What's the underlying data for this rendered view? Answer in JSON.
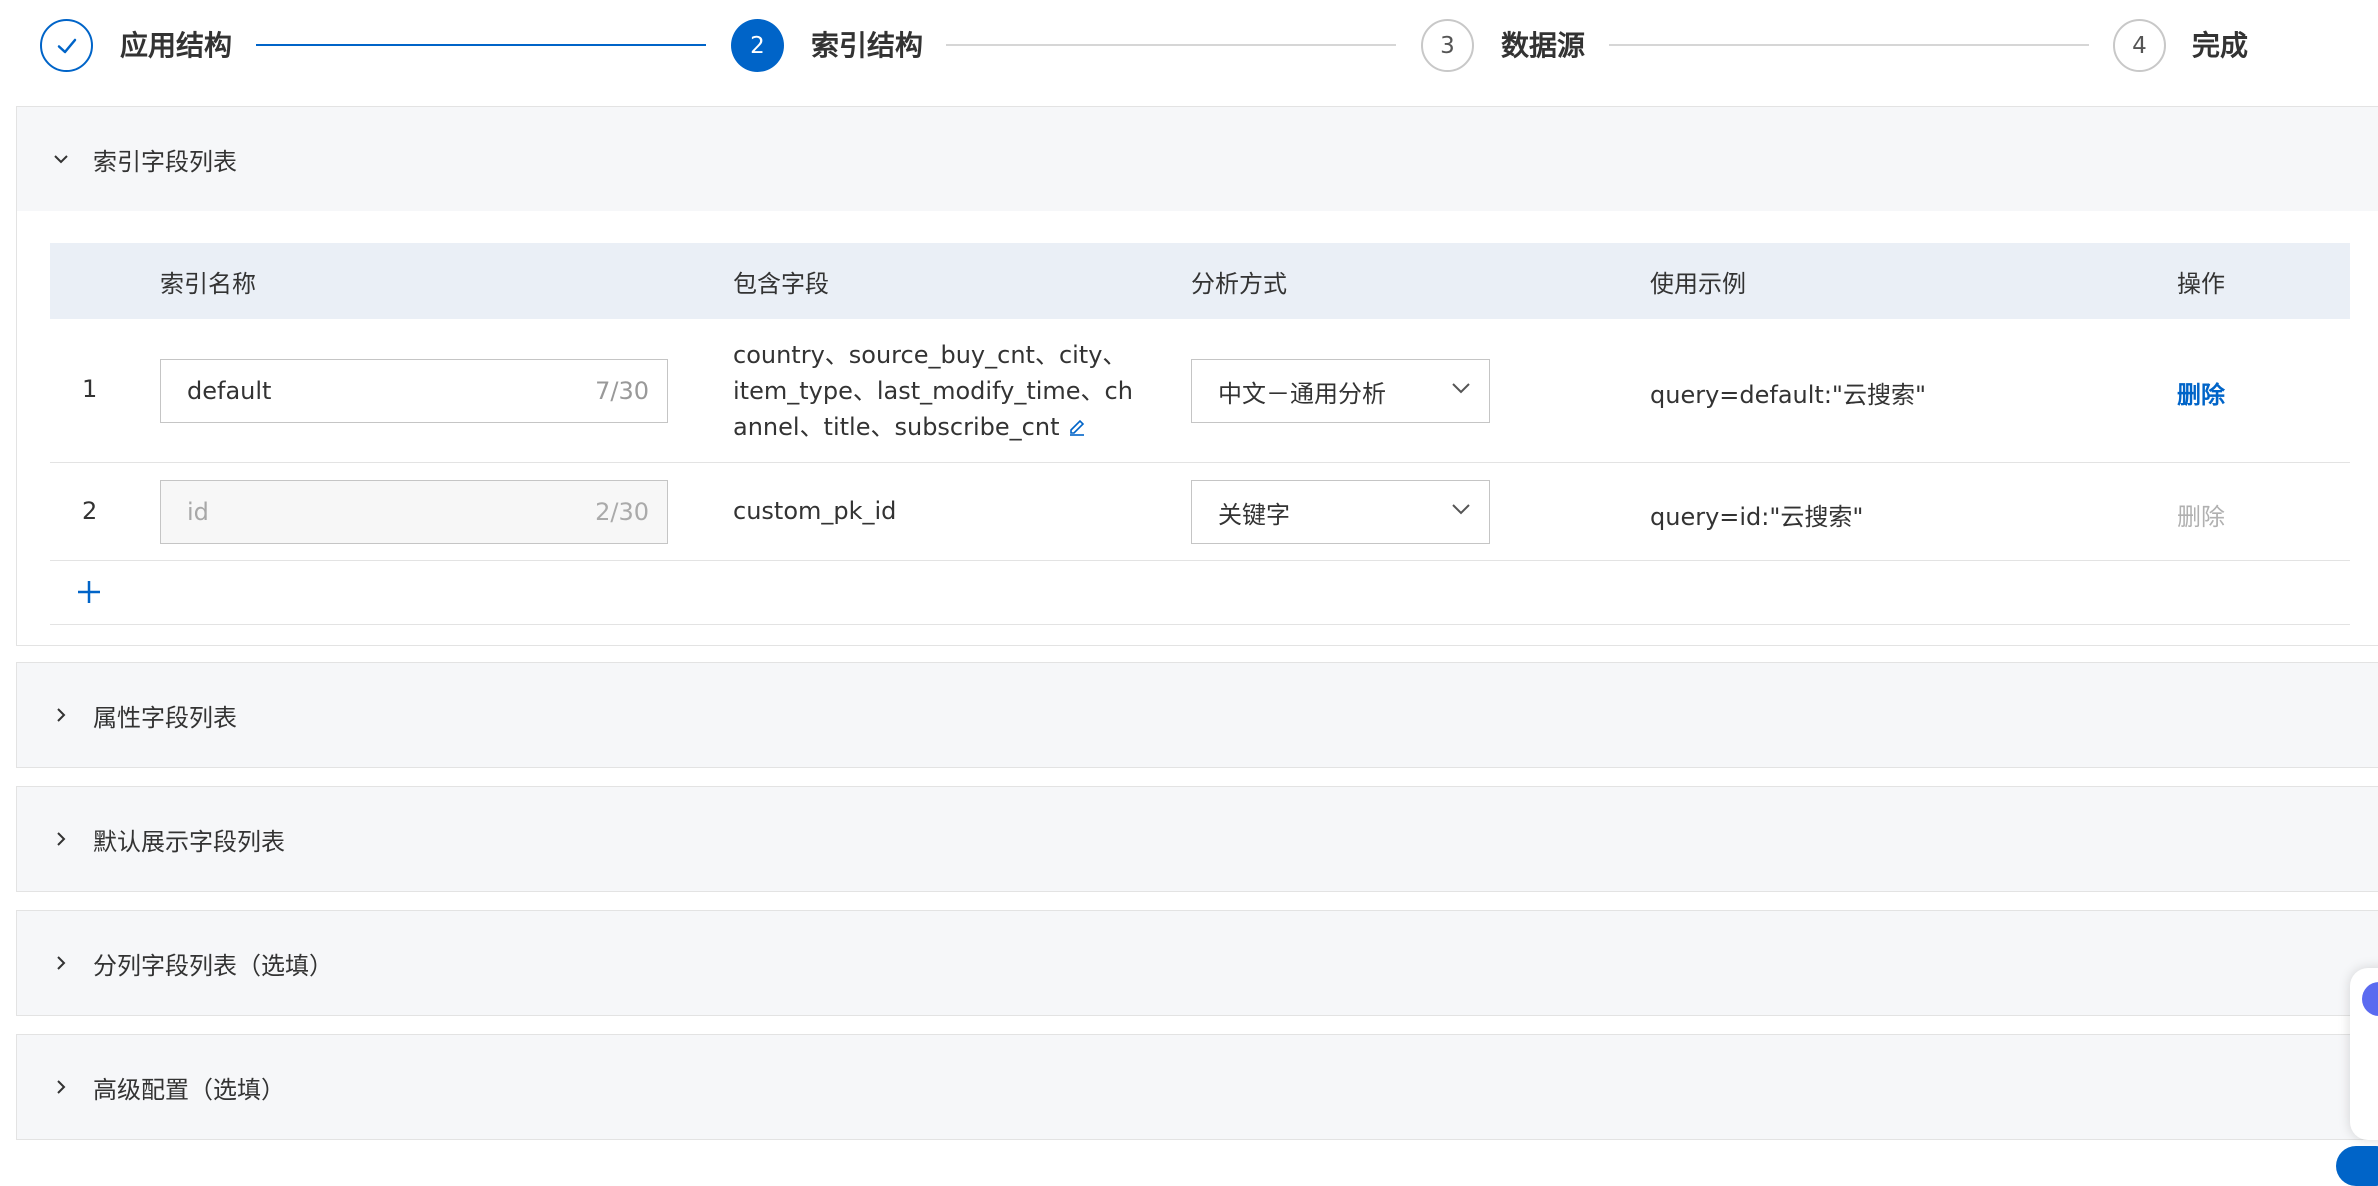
{
  "steps": [
    {
      "label": "应用结构",
      "state": "done",
      "number": ""
    },
    {
      "label": "索引结构",
      "state": "active",
      "number": "2"
    },
    {
      "label": "数据源",
      "state": "todo",
      "number": "3"
    },
    {
      "label": "完成",
      "state": "todo",
      "number": "4"
    }
  ],
  "index_panel": {
    "title": "索引字段列表",
    "expanded": true,
    "columns": {
      "name": "索引名称",
      "fields": "包含字段",
      "analysis": "分析方式",
      "example": "使用示例",
      "ops": "操作"
    },
    "rows": [
      {
        "no": "1",
        "name": "default",
        "name_count": "7/30",
        "fields": "country、source_buy_cnt、city、item_type、last_modify_time、channel、title、subscribe_cnt",
        "analysis": "中文－通用分析",
        "example": "query=default:\"云搜索\"",
        "delete": "删除"
      },
      {
        "no": "2",
        "name": "id",
        "name_count": "2/30",
        "fields": "custom_pk_id",
        "analysis": "关键字",
        "example": "query=id:\"云搜索\"",
        "delete": "删除"
      }
    ]
  },
  "panels": [
    {
      "title": "属性字段列表"
    },
    {
      "title": "默认展示字段列表"
    },
    {
      "title": "分列字段列表（选填）"
    },
    {
      "title": "高级配置（选填）"
    }
  ],
  "colors": {
    "primary": "#0064c8",
    "header_bg": "#eaeff6",
    "panel_bg": "#f6f7f9"
  }
}
